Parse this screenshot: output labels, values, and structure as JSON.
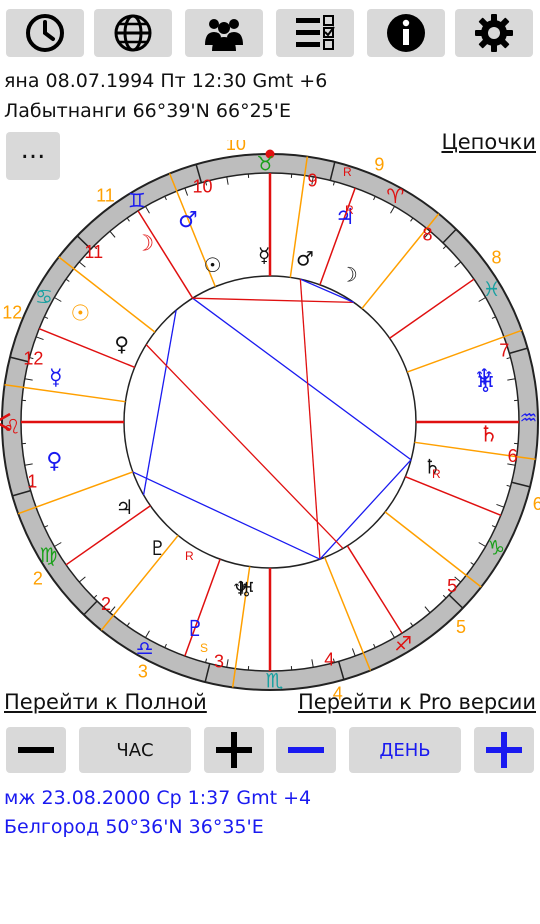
{
  "toolbar": {
    "icons": [
      "clock-icon",
      "globe-icon",
      "people-icon",
      "checklist-icon",
      "info-icon",
      "gear-icon"
    ]
  },
  "chart1": {
    "datetime": "яна 08.07.1994 Пт 12:30 Gmt +6",
    "place": "Лабытнанги 66°39'N 66°25'E"
  },
  "menu_button_label": "...",
  "chains_link": "Цепочки",
  "chart": {
    "house_numbers_outer": [
      "1",
      "2",
      "3",
      "4",
      "5",
      "6",
      "7",
      "8",
      "9",
      "10",
      "11",
      "12"
    ],
    "house_numbers_inner": [
      "1",
      "2",
      "3",
      "4",
      "5",
      "6",
      "7",
      "8",
      "9",
      "10",
      "11",
      "12"
    ],
    "planets_outer": [
      "☉",
      "☽",
      "☿",
      "♀",
      "♂",
      "♃",
      "♄",
      "♅",
      "♆",
      "♇"
    ],
    "planets_inner": [
      "☉",
      "☽",
      "☿",
      "♀",
      "♂",
      "♃",
      "♄",
      "♅",
      "♆",
      "♇"
    ],
    "retro_label": "R",
    "station_label": "S",
    "colors": {
      "ring": "#bdbdbd",
      "red": "#e01010",
      "orange": "#ffa000",
      "blue": "#1a1af0",
      "green": "#1aa01a",
      "teal": "#18a0a0"
    }
  },
  "links": {
    "full_version": "Перейти к Полной",
    "pro_version": "Перейти к Pro версии"
  },
  "controls": {
    "minus_symbol": "−",
    "plus_symbol": "+",
    "hour_label": "ЧАС",
    "day_label": "ДЕНЬ"
  },
  "chart2": {
    "datetime": "мж 23.08.2000 Ср 1:37 Gmt +4",
    "place": "Белгород 50°36'N 36°35'E"
  }
}
